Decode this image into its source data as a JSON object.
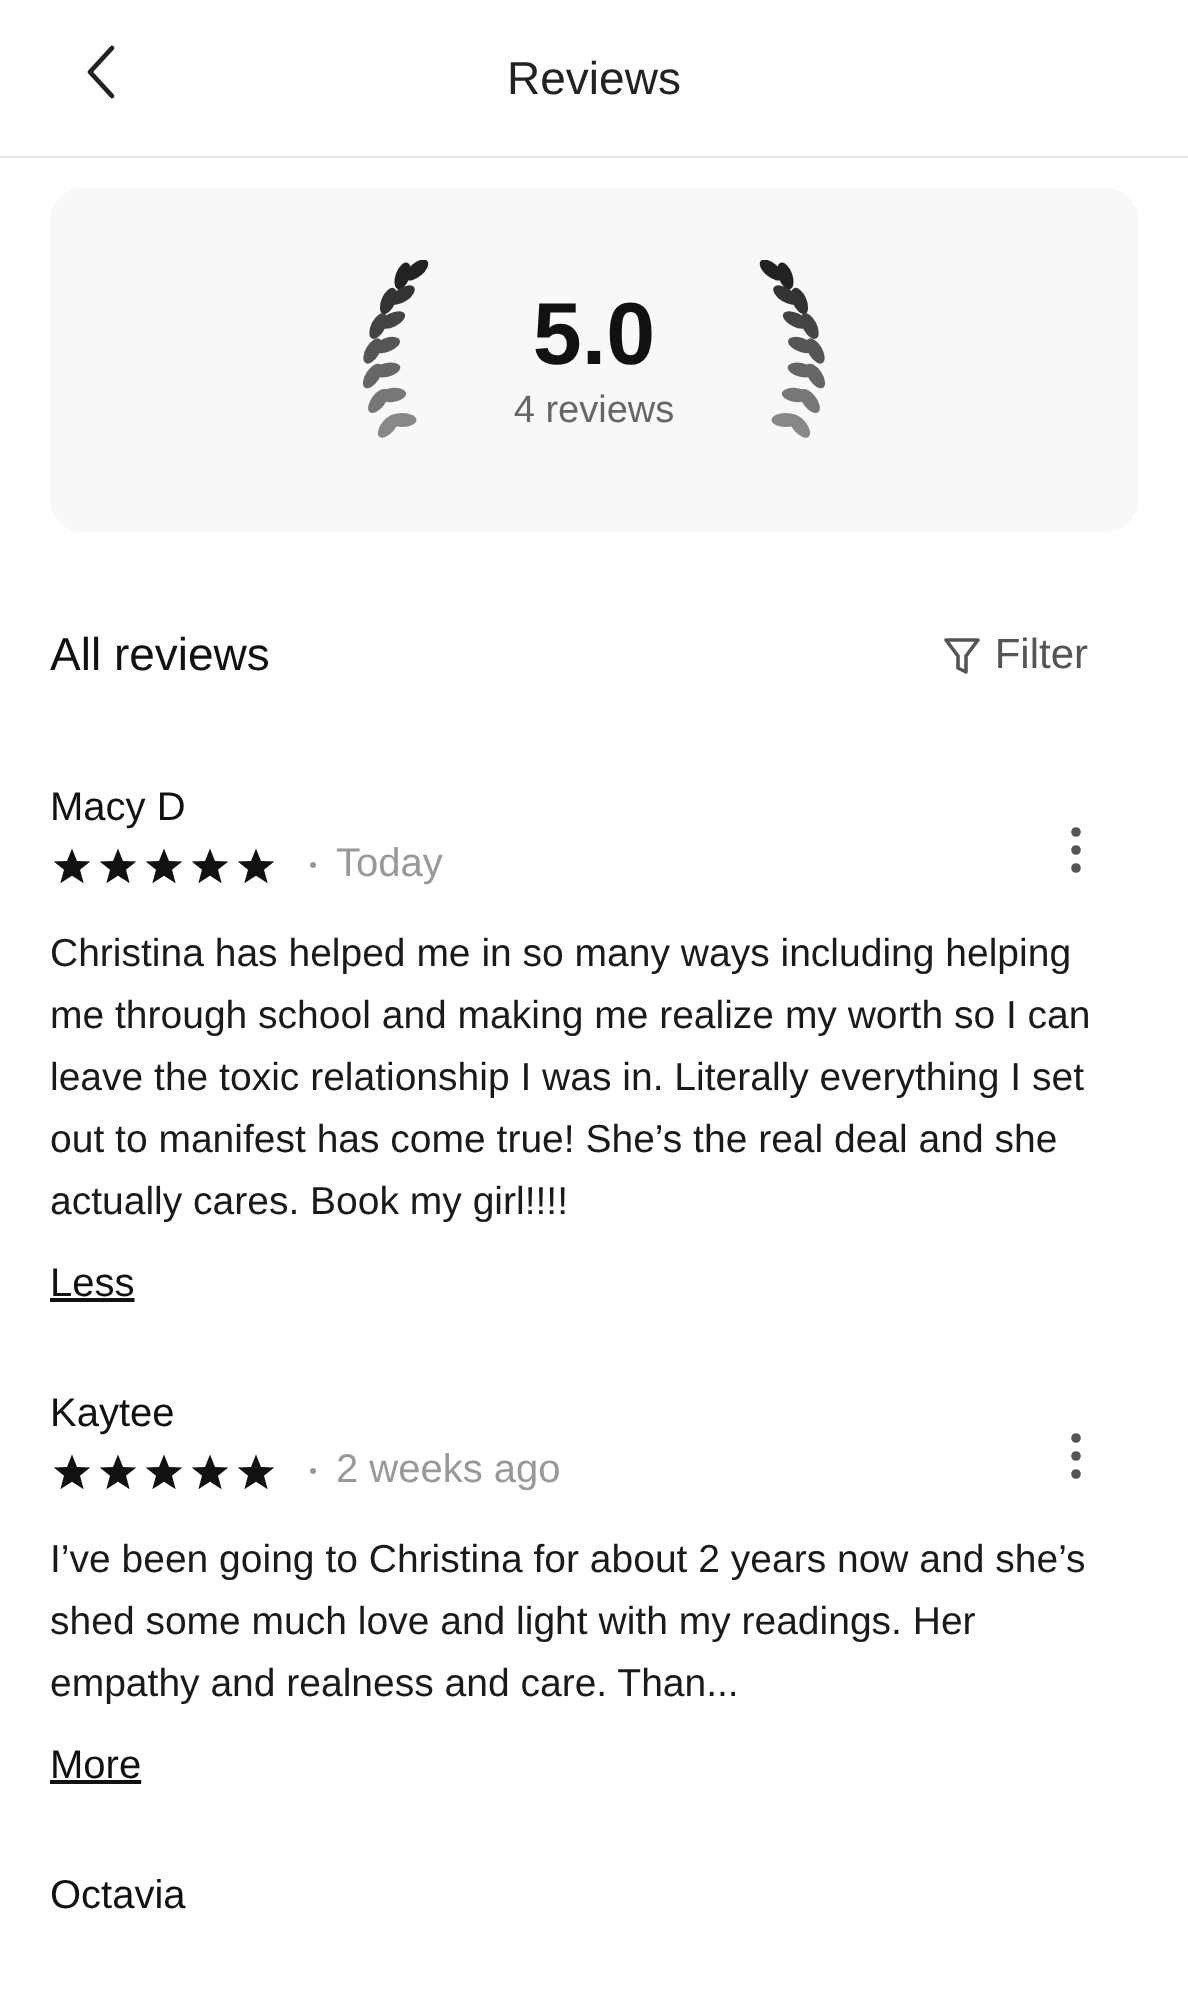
{
  "header": {
    "title": "Reviews"
  },
  "summary": {
    "rating": "5.0",
    "count": "4 reviews"
  },
  "section": {
    "title": "All reviews",
    "filter_label": "Filter"
  },
  "reviews": [
    {
      "author": "Macy D",
      "stars": 5,
      "date": "Today",
      "text": "Christina has helped me in so many ways including helping me through school and making me realize my worth so I can leave the toxic relationship I was in. Literally everything I set out to manifest has come true! She’s the real deal and she actually cares. Book my girl!!!!",
      "toggle": "Less"
    },
    {
      "author": "Kaytee",
      "stars": 5,
      "date": "2 weeks ago",
      "text": "I’ve been going to Christina for about 2 years now and she’s shed some much love and light with my readings. Her empathy and realness and care. Than...",
      "toggle": "More"
    },
    {
      "author": "Octavia"
    }
  ]
}
